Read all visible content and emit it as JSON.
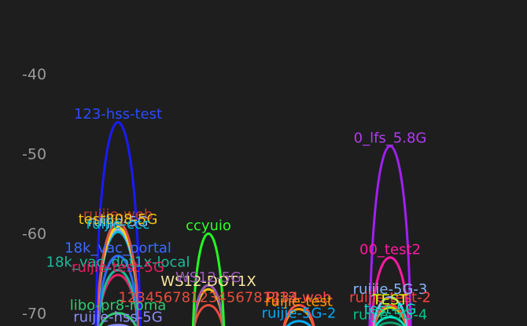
{
  "chart_data": {
    "type": "area",
    "title": "",
    "xlabel": "",
    "ylabel": "",
    "ylim": [
      -72,
      -38
    ],
    "yticks": [
      -40,
      -50,
      -60,
      -70
    ],
    "grid": false,
    "background": "#1e1e1e",
    "series": [
      {
        "name": "123-hss-test",
        "color": "#1a1aff",
        "center": 150,
        "width": 54,
        "peak": -46,
        "label_color": "#2a4bff"
      },
      {
        "name": "ruijie-web",
        "color": "#d9534f",
        "center": 150,
        "width": 52,
        "peak": -58.6,
        "label_color": "#c0392b"
      },
      {
        "name": "ruijie-5G",
        "color": "#8ab4f8",
        "center": 150,
        "width": 52,
        "peak": -59.5,
        "label_color": "#8ab4f8"
      },
      {
        "name": "test808-5G",
        "color": "#ffd700",
        "center": 150,
        "width": 52,
        "peak": -59.2,
        "label_color": "#f1c40f"
      },
      {
        "name": "ruijie-ccc",
        "color": "#00bcd4",
        "center": 150,
        "width": 52,
        "peak": -59.8,
        "label_color": "#00bcd4"
      },
      {
        "name": "18k_vac_portal",
        "color": "#2b6cff",
        "center": 150,
        "width": 50,
        "peak": -62.8,
        "label_color": "#3b6bff"
      },
      {
        "name": "18k_vac_dot1x-local",
        "color": "#1abc9c",
        "center": 150,
        "width": 50,
        "peak": -64.6,
        "label_color": "#1abc9c"
      },
      {
        "name": "ruijie-test-5G",
        "color": "#e91e63",
        "center": 150,
        "width": 50,
        "peak": -65.2,
        "label_color": "#e91e63"
      },
      {
        "name": "libo-pr8-roma",
        "color": "#2ecc71",
        "center": 150,
        "width": 50,
        "peak": -70,
        "label_color": "#2ecc71"
      },
      {
        "name": "ruijie-hss-5G",
        "color": "#8e8efc",
        "center": 150,
        "width": 50,
        "peak": -71.5,
        "label_color": "#8e8efc"
      },
      {
        "name": "ccyuio",
        "color": "#22ff22",
        "center": 265,
        "width": 38,
        "peak": -60,
        "label_color": "#2cff2c"
      },
      {
        "name": "WS12-DOT1X",
        "color": "#f1c40f",
        "center": 265,
        "width": 38,
        "peak": -67,
        "label_color": "#f9e79f"
      },
      {
        "name": "WS12-5G",
        "color": "#9b59b6",
        "center": 265,
        "width": 38,
        "peak": -66.5,
        "label_color": "#9b59b6"
      },
      {
        "name": "12345678123456781234",
        "color": "#e74c3c",
        "center": 265,
        "width": 38,
        "peak": -69,
        "label_color": "#e74c3c"
      },
      {
        "name": "PJ13-web",
        "color": "#ff4b4b",
        "center": 380,
        "width": 40,
        "peak": -69,
        "label_color": "#ff4b4b"
      },
      {
        "name": "ruijie-test",
        "color": "#ff9800",
        "center": 380,
        "width": 40,
        "peak": -69.5,
        "label_color": "#ff9800"
      },
      {
        "name": "ruijie-5G-2",
        "color": "#03a9f4",
        "center": 380,
        "width": 40,
        "peak": -71,
        "label_color": "#03a9f4"
      },
      {
        "name": "0_lfs_5.8G",
        "color": "#a020f0",
        "center": 496,
        "width": 50,
        "peak": -49,
        "label_color": "#b03cf0"
      },
      {
        "name": "00_test2",
        "color": "#ff1aa3",
        "center": 496,
        "width": 46,
        "peak": -63,
        "label_color": "#ff1aa3"
      },
      {
        "name": "ruijie-5G-3",
        "color": "#8ab4f8",
        "center": 496,
        "width": 44,
        "peak": -68,
        "label_color": "#8ab4f8"
      },
      {
        "name": "ruijie-test-2",
        "color": "#ff4040",
        "center": 496,
        "width": 44,
        "peak": -69,
        "label_color": "#ff4040"
      },
      {
        "name": "TEST",
        "color": "#c6e000",
        "center": 496,
        "width": 44,
        "peak": -69.3,
        "label_color": "#d4ff00"
      },
      {
        "name": "test-5G",
        "color": "#00e5c8",
        "center": 496,
        "width": 44,
        "peak": -70.5,
        "label_color": "#00e5c8"
      },
      {
        "name": "ruijie-5G-4",
        "color": "#0e9f6e",
        "center": 496,
        "width": 44,
        "peak": -71.2,
        "label_color": "#00c48c"
      }
    ]
  }
}
